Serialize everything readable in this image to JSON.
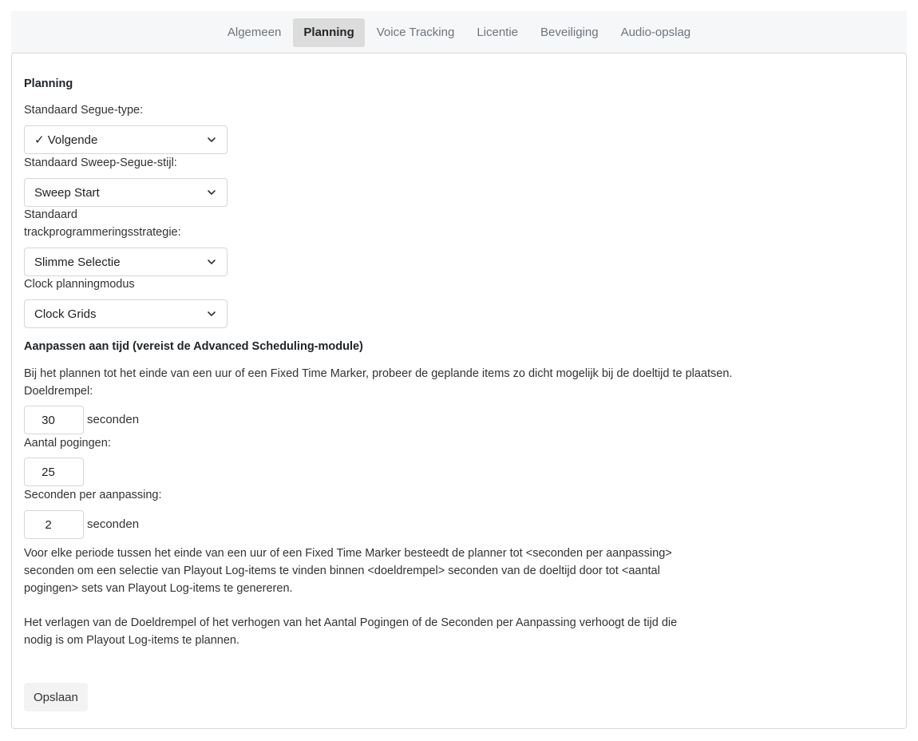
{
  "tabs": [
    {
      "label": "Algemeen",
      "active": false
    },
    {
      "label": "Planning",
      "active": true
    },
    {
      "label": "Voice Tracking",
      "active": false
    },
    {
      "label": "Licentie",
      "active": false
    },
    {
      "label": "Beveiliging",
      "active": false
    },
    {
      "label": "Audio-opslag",
      "active": false
    }
  ],
  "planning": {
    "heading": "Planning",
    "segue_type": {
      "label": "Standaard Segue-type:",
      "value": "✓ Volgende"
    },
    "sweep_segue_style": {
      "label": "Standaard Sweep-Segue-stijl:",
      "value": "Sweep Start"
    },
    "track_strategy": {
      "label_line1": "Standaard",
      "label_line2": "trackprogrammeringsstrategie:",
      "value": "Slimme Selectie"
    },
    "clock_mode": {
      "label": "Clock planningmodus",
      "value": "Clock Grids"
    }
  },
  "adjust": {
    "heading": "Aanpassen aan tijd (vereist de Advanced Scheduling-module)",
    "description": "Bij het plannen tot het einde van een uur of een Fixed Time Marker, probeer de geplande items zo dicht mogelijk bij de doeltijd te plaatsen.",
    "target_threshold": {
      "label": "Doeldrempel:",
      "value": "30",
      "unit": "seconden"
    },
    "attempts": {
      "label": "Aantal pogingen:",
      "value": "25"
    },
    "seconds_per_adjust": {
      "label": "Seconden per aanpassing:",
      "value": "2",
      "unit": "seconden"
    },
    "explanation_1": "Voor elke periode tussen het einde van een uur of een Fixed Time Marker besteedt de planner tot <seconden per aanpassing> seconden om een selectie van Playout Log-items te vinden binnen <doeldrempel> seconden van de doeltijd door tot <aantal pogingen> sets van Playout Log-items te genereren.",
    "explanation_2": "Het verlagen van de Doeldrempel of het verhogen van het Aantal Pogingen of de Seconden per Aanpassing verhoogt de tijd die nodig is om Playout Log-items te plannen."
  },
  "save_label": "Opslaan"
}
